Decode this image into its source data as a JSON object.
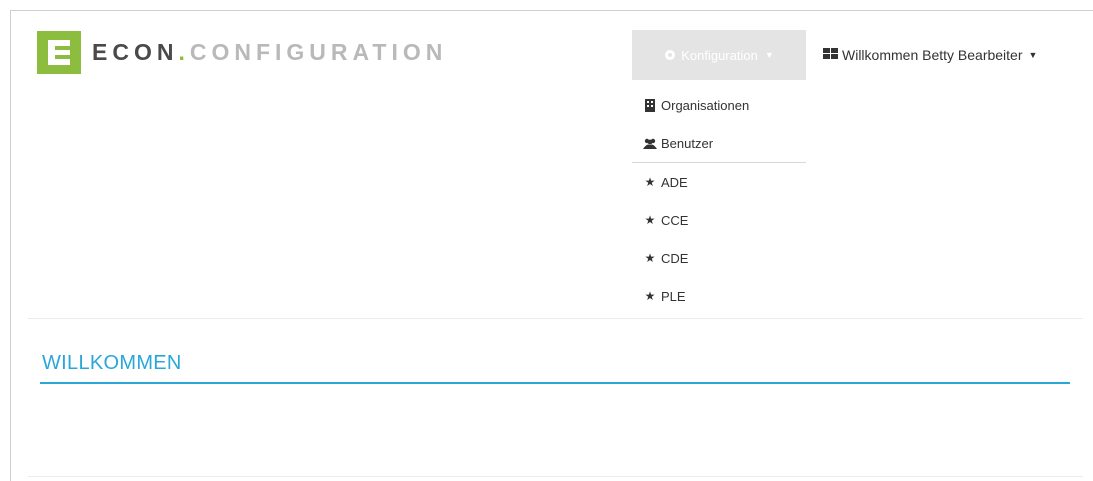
{
  "brand": {
    "logo_letter": "E",
    "name_part1": "ECON",
    "name_dot": ".",
    "name_part2": "CONFIGURATION",
    "logo_color": "#8cbd3f"
  },
  "navbar": {
    "config_menu": {
      "label": "Konfiguration",
      "icon": "gear-icon"
    },
    "user_menu": {
      "label": "Willkommen Betty Bearbeiter",
      "icon": "grid-icon"
    }
  },
  "dropdown": {
    "items": [
      {
        "label": "Organisationen",
        "icon": "building-icon"
      },
      {
        "label": "Benutzer",
        "icon": "users-icon"
      },
      {
        "label": "ADE",
        "icon": "star-icon"
      },
      {
        "label": "CCE",
        "icon": "star-icon"
      },
      {
        "label": "CDE",
        "icon": "star-icon"
      },
      {
        "label": "PLE",
        "icon": "star-icon"
      }
    ]
  },
  "main": {
    "heading": "WILLKOMMEN"
  },
  "colors": {
    "accent": "#29a8d8",
    "brand_green": "#8cbd3f"
  }
}
